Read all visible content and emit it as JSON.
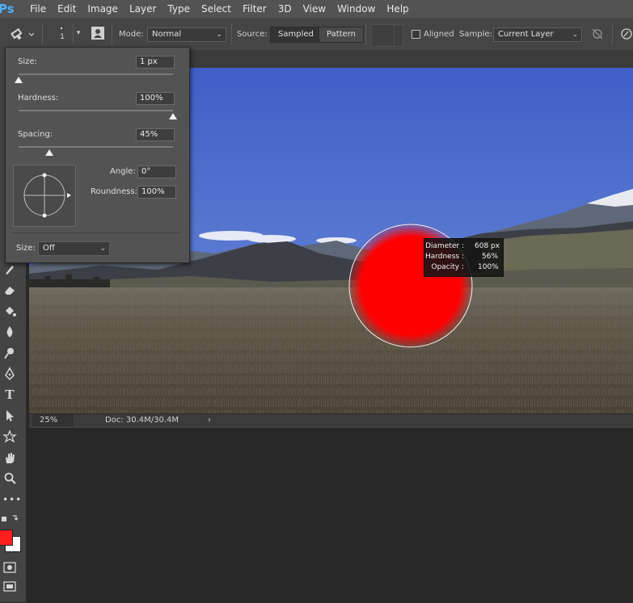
{
  "app": {
    "logo": "Ps"
  },
  "menu": [
    "File",
    "Edit",
    "Image",
    "Layer",
    "Type",
    "Select",
    "Filter",
    "3D",
    "View",
    "Window",
    "Help"
  ],
  "options": {
    "brush_size_display": "1",
    "mode_label": "Mode:",
    "mode_value": "Normal",
    "source_label": "Source:",
    "source_sampled": "Sampled",
    "source_pattern": "Pattern",
    "aligned_label": "Aligned",
    "sample_label": "Sample:",
    "sample_value": "Current Layer"
  },
  "brush_panel": {
    "size_label": "Size:",
    "size_value": "1 px",
    "size_level": 0.0,
    "hardness_label": "Hardness:",
    "hardness_value": "100%",
    "hardness_level": 1.0,
    "spacing_label": "Spacing:",
    "spacing_value": "45%",
    "spacing_level": 0.2,
    "angle_label": "Angle:",
    "angle_value": "0°",
    "roundness_label": "Roundness:",
    "roundness_value": "100%",
    "pen_size_label": "Size:",
    "pen_size_value": "Off"
  },
  "tooltip": {
    "diameter_label": "Diameter :",
    "diameter_value": "608 px",
    "hardness_label": "Hardness :",
    "hardness_value": "56%",
    "opacity_label": "Opacity :",
    "opacity_value": "100%"
  },
  "status": {
    "zoom": "25%",
    "doc": "Doc: 30.4M/30.4M"
  },
  "colors": {
    "foreground": "#ff1e1e",
    "background": "#ffffff",
    "brush_preview": "#ff0000",
    "ps_blue": "#4fb0ff"
  }
}
